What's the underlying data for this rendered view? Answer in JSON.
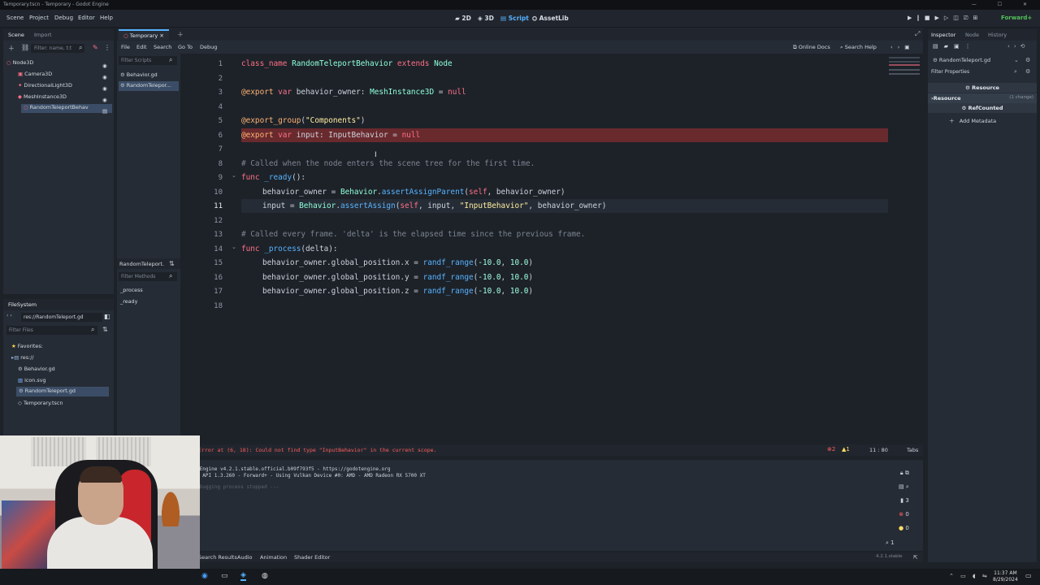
{
  "window": {
    "title": "Temporary.tscn - Temporary - Godot Engine",
    "controls": "— ☐ ✕"
  },
  "menu": [
    "Scene",
    "Project",
    "Debug",
    "Editor",
    "Help"
  ],
  "workspaces": [
    "2D",
    "3D",
    "Script",
    "AssetLib"
  ],
  "renderer": "Forward+",
  "scene_dock": {
    "tabs": [
      "Scene",
      "Import"
    ],
    "filter_placeholder": "Filter: name, t:t",
    "nodes": [
      "Node3D",
      "Camera3D",
      "DirectionalLight3D",
      "MeshInstance3D",
      "RandomTeleportBehav"
    ]
  },
  "filesystem": {
    "tab": "FileSystem",
    "path": "res://RandomTeleport.gd",
    "filter_placeholder": "Filter Files",
    "items": [
      "Favorites:",
      "res://",
      "Behavior.gd",
      "icon.svg",
      "RandomTeleport.gd",
      "Temporary.tscn"
    ]
  },
  "script_editor": {
    "scene_tab": "Temporary",
    "menu": [
      "File",
      "Edit",
      "Search",
      "Go To",
      "Debug"
    ],
    "right_links": [
      "Online Docs",
      "Search Help"
    ],
    "filter_scripts": "Filter Scripts",
    "scripts": [
      "Behavior.gd",
      "RandomTelepor..."
    ],
    "method_header": "RandomTeleport.",
    "filter_methods": "Filter Methods",
    "methods": [
      "_process",
      "_ready"
    ],
    "line_numbers": [
      "1",
      "2",
      "3",
      "4",
      "5",
      "6",
      "7",
      "8",
      "9",
      "10",
      "11",
      "12",
      "13",
      "14",
      "15",
      "16",
      "17",
      "18"
    ],
    "code": {
      "l1": [
        "class_name ",
        "RandomTeleportBehavior",
        " extends ",
        "Node"
      ],
      "l3": [
        "@export",
        " var ",
        "behavior_owner",
        ": ",
        "MeshInstance3D",
        " = ",
        "null"
      ],
      "l5": [
        "@export_group",
        "(",
        "\"Components\"",
        ")"
      ],
      "l6": [
        "@export",
        " var ",
        "input",
        ": ",
        "InputBehavior",
        " = ",
        "null"
      ],
      "l8": "# Called when the node enters the scene tree for the first time.",
      "l9": [
        "func ",
        "_ready",
        "():"
      ],
      "l10": [
        "behavior_owner = ",
        "Behavior",
        ".",
        "assertAssignParent",
        "(",
        "self",
        ", behavior_owner)"
      ],
      "l11": [
        "input = ",
        "Behavior",
        ".",
        "assertAssign",
        "(",
        "self",
        ", input, ",
        "\"InputBehavior\"",
        ", behavior_owner)"
      ],
      "l13": "# Called every frame. 'delta' is the elapsed time since the previous frame.",
      "l14": [
        "func ",
        "_process",
        "(delta):"
      ],
      "l15": [
        "behavior_owner.global_position.x = ",
        "randf_range",
        "(",
        "-10.0",
        ", ",
        "10.0",
        ")"
      ],
      "l16": [
        "behavior_owner.global_position.y = ",
        "randf_range",
        "(",
        "-10.0",
        ", ",
        "10.0",
        ")"
      ],
      "l17": [
        "behavior_owner.global_position.z = ",
        "randf_range",
        "(",
        "-10.0",
        ", ",
        "10.0",
        ")"
      ]
    },
    "error": "Error at (6, 18): Could not find type \"InputBehavior\" in the current scope.",
    "errors_count": "2",
    "warnings_count": "1",
    "cursor": "11 : 80",
    "indent": "Tabs"
  },
  "output": {
    "lines": [
      "Godot Engine v4.2.1.stable.official.b09f793f5 - https://godotengine.org",
      "Vulkan API 1.3.260 - Forward+ - Using Vulkan Device #0: AMD - AMD Radeon RX 5700 XT",
      "--- Debugging process stopped ---"
    ],
    "counts": [
      "3",
      "0",
      "0",
      "1"
    ]
  },
  "bottom_tabs": [
    "Search Results",
    "Audio",
    "Animation",
    "Shader Editor"
  ],
  "version": "4.2.1.stable",
  "inspector": {
    "tabs": [
      "Inspector",
      "Node",
      "History"
    ],
    "object": "RandomTeleport.gd",
    "filter": "Filter Properties",
    "resource_header": "Resource",
    "resource_section": "Resource",
    "resource_note": "(1 change)",
    "refcounted": "RefCounted",
    "add_metadata": "Add Metadata"
  },
  "taskbar": {
    "time": "11:37 AM",
    "date": "8/29/2024"
  },
  "colors": {
    "accent": "#57b3ff",
    "error_line": "#692a2e",
    "keyword": "#ff7085",
    "annotation": "#ffb373"
  }
}
